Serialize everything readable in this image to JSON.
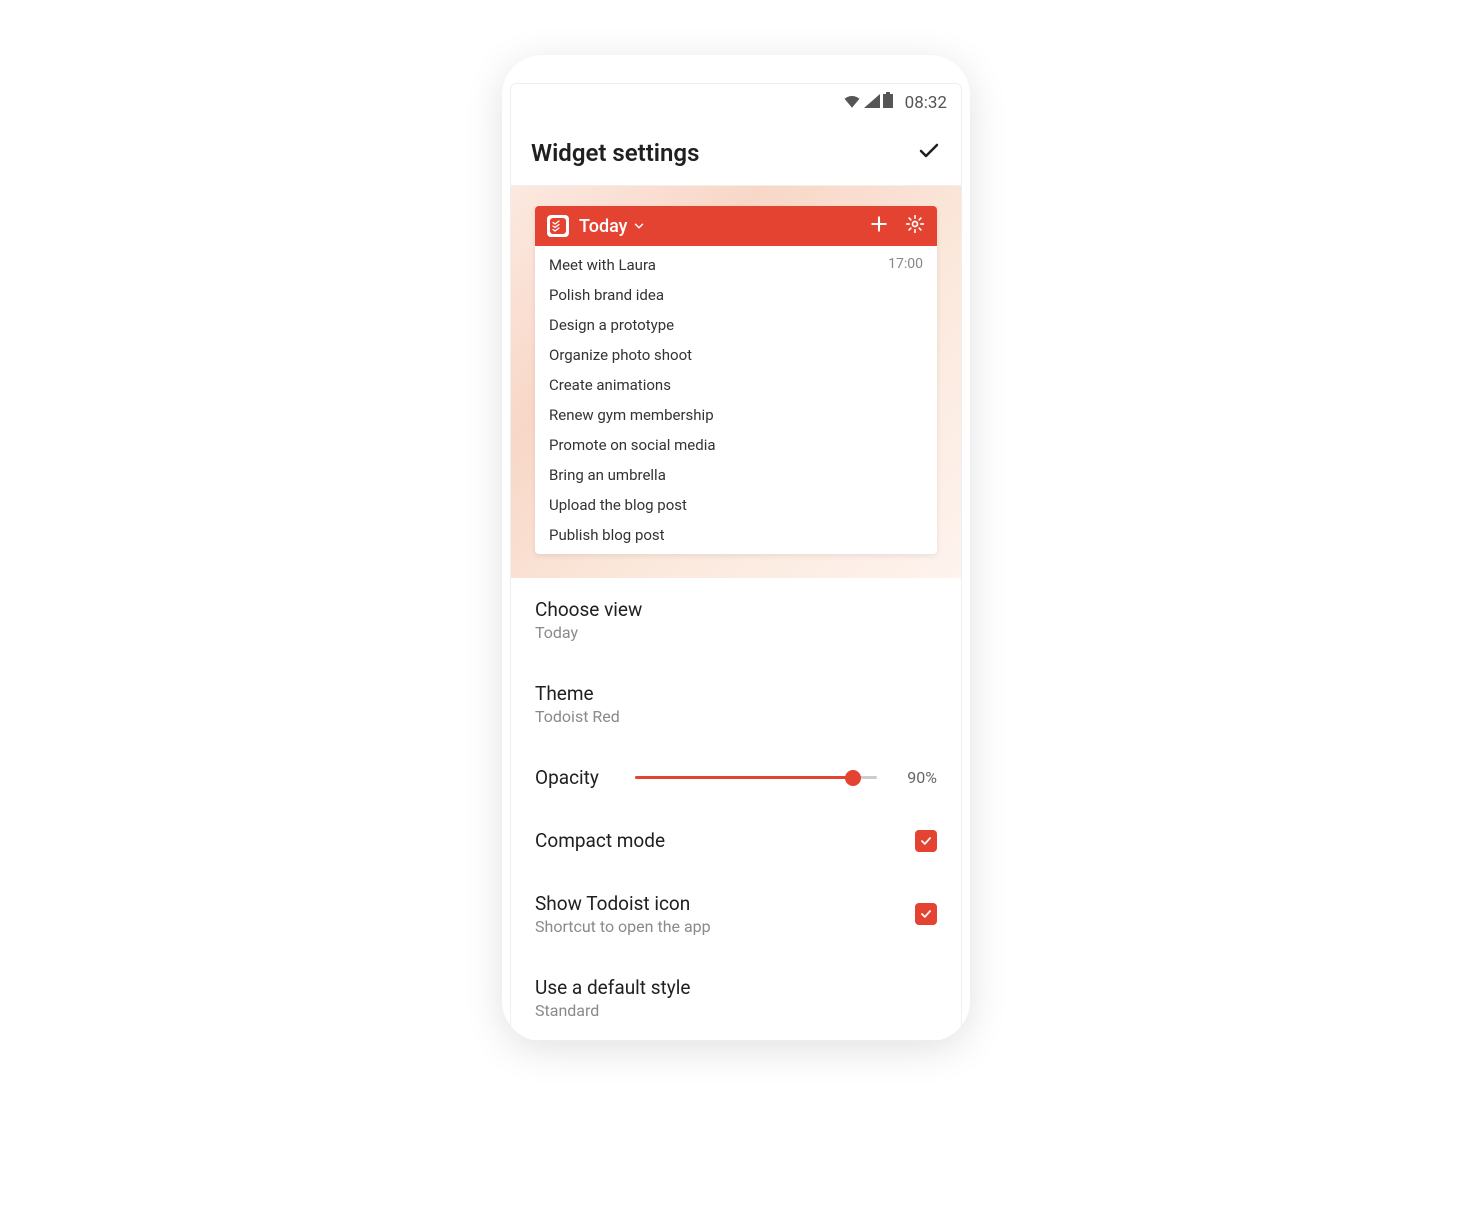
{
  "status_bar": {
    "time": "08:32"
  },
  "header": {
    "title": "Widget settings"
  },
  "widget_preview": {
    "title": "Today",
    "tasks": [
      {
        "name": "Meet with Laura",
        "time": "17:00"
      },
      {
        "name": "Polish brand idea",
        "time": ""
      },
      {
        "name": "Design a prototype",
        "time": ""
      },
      {
        "name": "Organize photo shoot",
        "time": ""
      },
      {
        "name": "Create animations",
        "time": ""
      },
      {
        "name": "Renew gym membership",
        "time": ""
      },
      {
        "name": "Promote on social media",
        "time": ""
      },
      {
        "name": "Bring an umbrella",
        "time": ""
      },
      {
        "name": "Upload the blog post",
        "time": ""
      },
      {
        "name": "Publish blog post",
        "time": ""
      }
    ]
  },
  "settings": {
    "choose_view": {
      "label": "Choose view",
      "value": "Today"
    },
    "theme": {
      "label": "Theme",
      "value": "Todoist Red"
    },
    "opacity": {
      "label": "Opacity",
      "percent_label": "90%",
      "percent": 90
    },
    "compact_mode": {
      "label": "Compact mode",
      "checked": true
    },
    "show_icon": {
      "label": "Show Todoist icon",
      "subtitle": "Shortcut to open the app",
      "checked": true
    },
    "default_style": {
      "label": "Use a default style",
      "value": "Standard"
    }
  }
}
